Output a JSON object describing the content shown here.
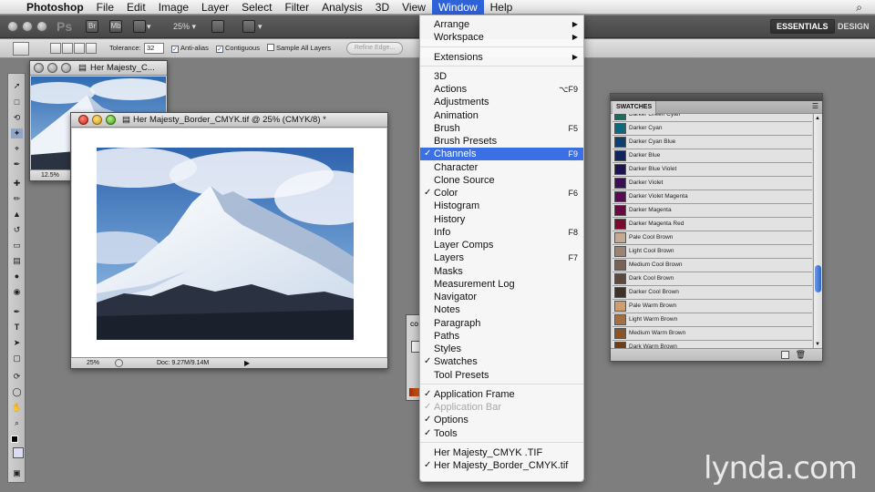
{
  "menubar": {
    "app_name": "Photoshop",
    "items": [
      "File",
      "Edit",
      "Image",
      "Layer",
      "Select",
      "Filter",
      "Analysis",
      "3D",
      "View",
      "Window",
      "Help"
    ],
    "active_item": "Window"
  },
  "appbar": {
    "logo": "Ps",
    "bridge_label": "Br",
    "minibridge_label": "Mb",
    "zoom_value": "25%",
    "workspaces": [
      "ESSENTIALS",
      "DESIGN"
    ],
    "active_workspace": "ESSENTIALS"
  },
  "options_bar": {
    "tolerance_label": "Tolerance:",
    "tolerance_value": "32",
    "anti_alias_label": "Anti-alias",
    "anti_alias_checked": true,
    "contiguous_label": "Contiguous",
    "contiguous_checked": true,
    "sample_all_layers_label": "Sample All Layers",
    "sample_all_layers_checked": false,
    "refine_edge_label": "Refine Edge..."
  },
  "documents": [
    {
      "title": "Her Majesty_C...",
      "zoom": "12.5%"
    },
    {
      "title": "Her Majesty_Border_CMYK.tif @ 25% (CMYK/8) *",
      "zoom": "25%",
      "doc_info": "Doc: 9.27M/9.14M"
    }
  ],
  "window_menu": {
    "groups": [
      [
        {
          "label": "Arrange",
          "submenu": true
        },
        {
          "label": "Workspace",
          "submenu": true
        }
      ],
      [
        {
          "label": "Extensions",
          "submenu": true
        }
      ],
      [
        {
          "label": "3D"
        },
        {
          "label": "Actions",
          "shortcut": "⌥F9"
        },
        {
          "label": "Adjustments"
        },
        {
          "label": "Animation"
        },
        {
          "label": "Brush",
          "shortcut": "F5"
        },
        {
          "label": "Brush Presets"
        },
        {
          "label": "Channels",
          "shortcut": "F9",
          "checked": true,
          "highlighted": true
        },
        {
          "label": "Character"
        },
        {
          "label": "Clone Source"
        },
        {
          "label": "Color",
          "shortcut": "F6",
          "checked": true
        },
        {
          "label": "Histogram"
        },
        {
          "label": "History"
        },
        {
          "label": "Info",
          "shortcut": "F8"
        },
        {
          "label": "Layer Comps"
        },
        {
          "label": "Layers",
          "shortcut": "F7"
        },
        {
          "label": "Masks"
        },
        {
          "label": "Measurement Log"
        },
        {
          "label": "Navigator"
        },
        {
          "label": "Notes"
        },
        {
          "label": "Paragraph"
        },
        {
          "label": "Paths"
        },
        {
          "label": "Styles"
        },
        {
          "label": "Swatches",
          "checked": true
        },
        {
          "label": "Tool Presets"
        }
      ],
      [
        {
          "label": "Application Frame",
          "checked": true
        },
        {
          "label": "Application Bar",
          "checked": true,
          "disabled": true
        },
        {
          "label": "Options",
          "checked": true
        },
        {
          "label": "Tools",
          "checked": true
        }
      ],
      [
        {
          "label": "Her Majesty_CMYK .TIF"
        },
        {
          "label": "Her Majesty_Border_CMYK.tif",
          "checked": true
        }
      ]
    ]
  },
  "swatches_panel": {
    "tab_label": "SWATCHES",
    "swatches": [
      {
        "name": "Darker Green Cyan",
        "color": "#1b6a5c"
      },
      {
        "name": "Darker Cyan",
        "color": "#0b6a80"
      },
      {
        "name": "Darker Cyan Blue",
        "color": "#0d3f70"
      },
      {
        "name": "Darker Blue",
        "color": "#0f2460"
      },
      {
        "name": "Darker Blue Violet",
        "color": "#1f1252"
      },
      {
        "name": "Darker Violet",
        "color": "#3a0f55"
      },
      {
        "name": "Darker Violet Magenta",
        "color": "#560c55"
      },
      {
        "name": "Darker Magenta",
        "color": "#6a0844"
      },
      {
        "name": "Darker Magenta Red",
        "color": "#7b0a2d"
      },
      {
        "name": "Pale Cool Brown",
        "color": "#c5aa92"
      },
      {
        "name": "Light Cool Brown",
        "color": "#9b8272"
      },
      {
        "name": "Medium Cool Brown",
        "color": "#7a6356"
      },
      {
        "name": "Dark Cool Brown",
        "color": "#5c483c"
      },
      {
        "name": "Darker Cool Brown",
        "color": "#40302a"
      },
      {
        "name": "Pale Warm Brown",
        "color": "#cf9c6c"
      },
      {
        "name": "Light Warm Brown",
        "color": "#a66f42"
      },
      {
        "name": "Medium Warm Brown",
        "color": "#8a5428"
      },
      {
        "name": "Dark Warm Brown",
        "color": "#6d3e18"
      }
    ]
  },
  "small_panel": {
    "title": "CO"
  },
  "watermark": "lynda.com"
}
